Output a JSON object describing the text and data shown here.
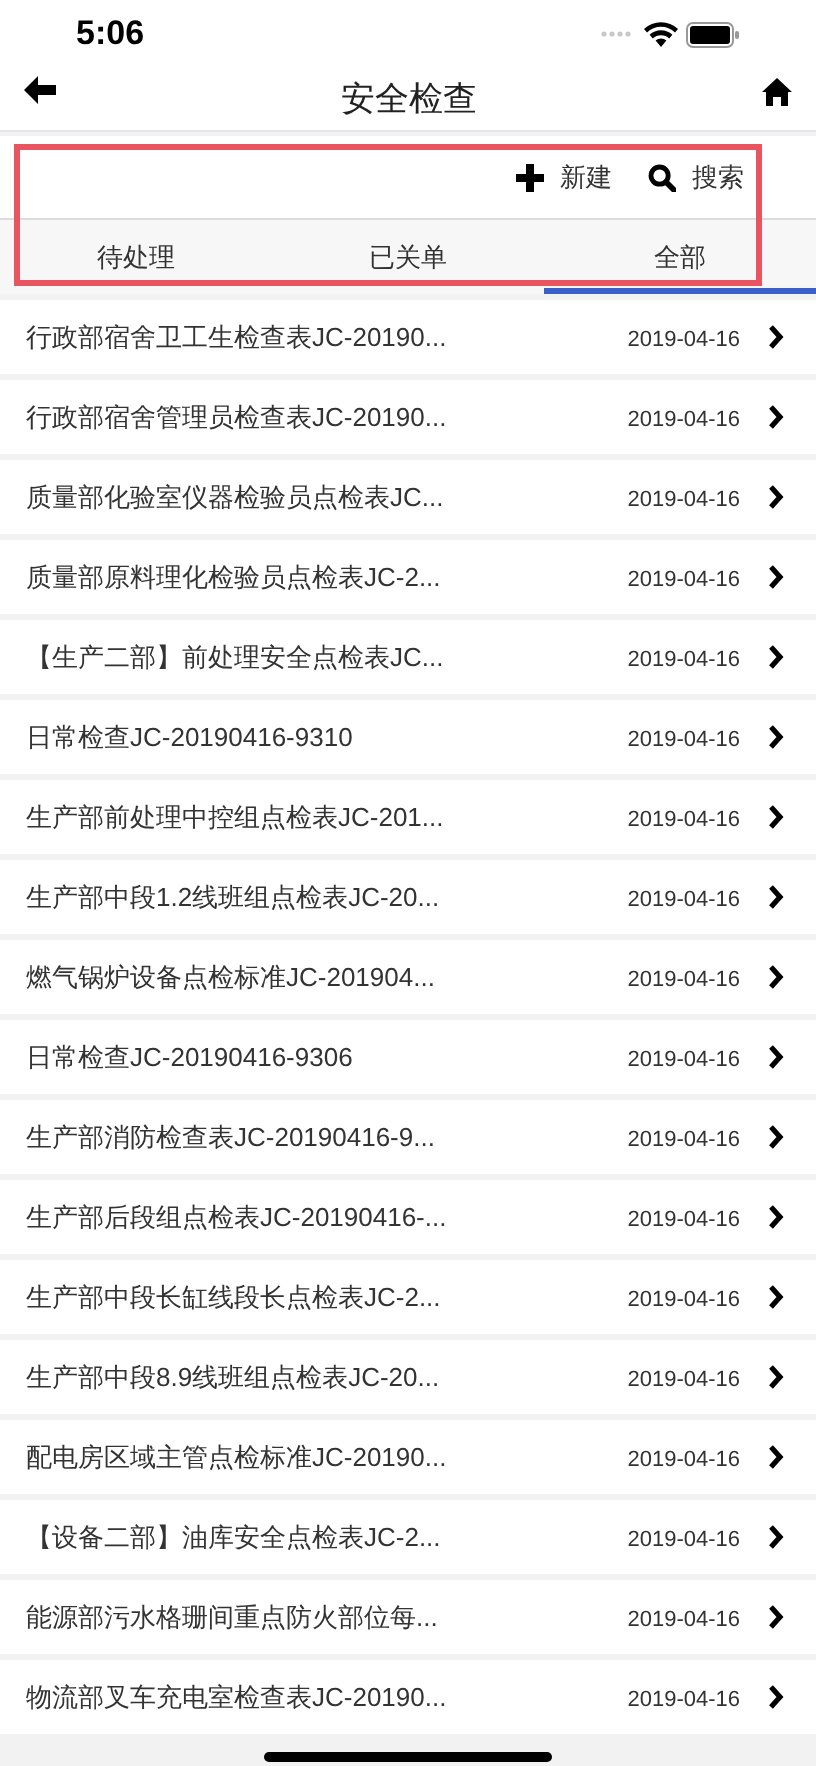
{
  "status_bar": {
    "time": "5:06"
  },
  "nav": {
    "title": "安全检查"
  },
  "toolbar": {
    "actions": [
      {
        "kind": "add",
        "label": "新建"
      },
      {
        "kind": "search",
        "label": "搜索"
      }
    ]
  },
  "tabs": [
    {
      "label": "待处理",
      "selected": false
    },
    {
      "label": "已关单",
      "selected": false
    },
    {
      "label": "全部",
      "selected": true
    }
  ],
  "records": [
    {
      "title": "行政部宿舍卫工生检查表JC-20190...",
      "date": "2019-04-16"
    },
    {
      "title": "行政部宿舍管理员检查表JC-20190...",
      "date": "2019-04-16"
    },
    {
      "title": "质量部化验室仪器检验员点检表JC...",
      "date": "2019-04-16"
    },
    {
      "title": "质量部原料理化检验员点检表JC-2...",
      "date": "2019-04-16"
    },
    {
      "title": "【生产二部】前处理安全点检表JC...",
      "date": "2019-04-16"
    },
    {
      "title": "日常检查JC-20190416-9310",
      "date": "2019-04-16"
    },
    {
      "title": "生产部前处理中控组点检表JC-201...",
      "date": "2019-04-16"
    },
    {
      "title": "生产部中段1.2线班组点检表JC-20...",
      "date": "2019-04-16"
    },
    {
      "title": "燃气锅炉设备点检标准JC-201904...",
      "date": "2019-04-16"
    },
    {
      "title": "日常检查JC-20190416-9306",
      "date": "2019-04-16"
    },
    {
      "title": "生产部消防检查表JC-20190416-9...",
      "date": "2019-04-16"
    },
    {
      "title": "生产部后段组点检表JC-20190416-...",
      "date": "2019-04-16"
    },
    {
      "title": "生产部中段长缸线段长点检表JC-2...",
      "date": "2019-04-16"
    },
    {
      "title": "生产部中段8.9线班组点检表JC-20...",
      "date": "2019-04-16"
    },
    {
      "title": "配电房区域主管点检标准JC-20190...",
      "date": "2019-04-16"
    },
    {
      "title": "【设备二部】油库安全点检表JC-2...",
      "date": "2019-04-16"
    },
    {
      "title": "能源部污水格珊间重点防火部位每...",
      "date": "2019-04-16"
    },
    {
      "title": "物流部叉车充电室检查表JC-20190...",
      "date": "2019-04-16"
    }
  ]
}
